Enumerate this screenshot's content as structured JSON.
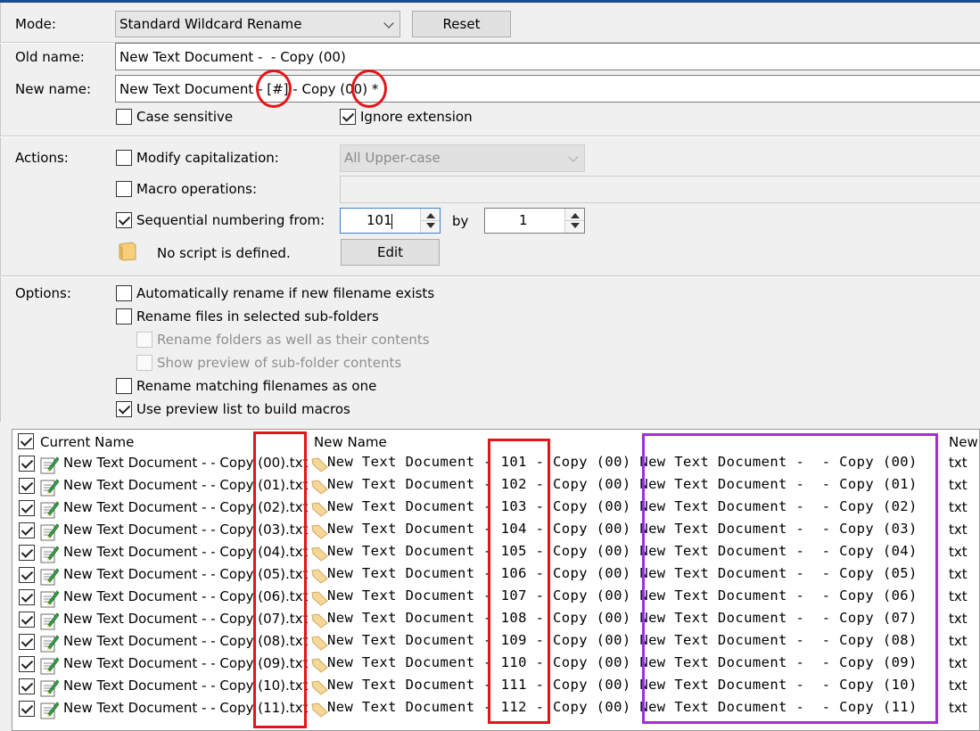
{
  "mode": {
    "label": "Mode:",
    "value": "Standard Wildcard Rename",
    "reset_label": "Reset"
  },
  "old_name": {
    "label": "Old name:",
    "value": "New Text Document -  - Copy (00)"
  },
  "new_name": {
    "label": "New name:",
    "value": "New Text Document - [#] - Copy (00) *"
  },
  "case_sensitive": {
    "label": "Case sensitive",
    "checked": false
  },
  "ignore_extension": {
    "label": "Ignore extension",
    "checked": true
  },
  "actions": {
    "label": "Actions:",
    "modify_cap": {
      "label": "Modify capitalization:",
      "checked": false,
      "value": "All Upper-case"
    },
    "macro_ops": {
      "label": "Macro operations:",
      "checked": false,
      "value": ""
    },
    "sequential": {
      "label": "Sequential numbering from:",
      "checked": true,
      "from": "101",
      "by_label": "by",
      "by": "1"
    },
    "script": {
      "text": "No script is defined.",
      "edit_label": "Edit"
    }
  },
  "options": {
    "label": "Options:",
    "items": [
      {
        "label": "Automatically rename if new filename exists",
        "checked": false,
        "enabled": true
      },
      {
        "label": "Rename files in selected sub-folders",
        "checked": false,
        "enabled": true
      },
      {
        "label": "Rename folders as well as their contents",
        "checked": false,
        "enabled": false
      },
      {
        "label": "Show preview of sub-folder contents",
        "checked": false,
        "enabled": false
      },
      {
        "label": "Rename matching filenames as one",
        "checked": false,
        "enabled": true
      },
      {
        "label": "Use preview list to build macros",
        "checked": true,
        "enabled": true
      }
    ]
  },
  "list": {
    "headers": {
      "current": "Current Name",
      "new": "New Name",
      "ext": "New"
    },
    "rows": [
      {
        "current": "New Text Document -  - Copy (00).txt",
        "new": "New Text Document - 101 - Copy (00) New Text Document -  - Copy (00)",
        "ext": "txt"
      },
      {
        "current": "New Text Document -  - Copy (01).txt",
        "new": "New Text Document - 102 - Copy (00) New Text Document -  - Copy (01)",
        "ext": "txt"
      },
      {
        "current": "New Text Document -  - Copy (02).txt",
        "new": "New Text Document - 103 - Copy (00) New Text Document -  - Copy (02)",
        "ext": "txt"
      },
      {
        "current": "New Text Document -  - Copy (03).txt",
        "new": "New Text Document - 104 - Copy (00) New Text Document -  - Copy (03)",
        "ext": "txt"
      },
      {
        "current": "New Text Document -  - Copy (04).txt",
        "new": "New Text Document - 105 - Copy (00) New Text Document -  - Copy (04)",
        "ext": "txt"
      },
      {
        "current": "New Text Document -  - Copy (05).txt",
        "new": "New Text Document - 106 - Copy (00) New Text Document -  - Copy (05)",
        "ext": "txt"
      },
      {
        "current": "New Text Document -  - Copy (06).txt",
        "new": "New Text Document - 107 - Copy (00) New Text Document -  - Copy (06)",
        "ext": "txt"
      },
      {
        "current": "New Text Document -  - Copy (07).txt",
        "new": "New Text Document - 108 - Copy (00) New Text Document -  - Copy (07)",
        "ext": "txt"
      },
      {
        "current": "New Text Document -  - Copy (08).txt",
        "new": "New Text Document - 109 - Copy (00) New Text Document -  - Copy (08)",
        "ext": "txt"
      },
      {
        "current": "New Text Document -  - Copy (09).txt",
        "new": "New Text Document - 110 - Copy (00) New Text Document -  - Copy (09)",
        "ext": "txt"
      },
      {
        "current": "New Text Document -  - Copy (10).txt",
        "new": "New Text Document - 111 - Copy (00) New Text Document -  - Copy (10)",
        "ext": "txt"
      },
      {
        "current": "New Text Document -  - Copy (11).txt",
        "new": "New Text Document - 112 - Copy (00) New Text Document -  - Copy (11)",
        "ext": "txt"
      }
    ]
  },
  "colors": {
    "highlight_red": "#e3151a",
    "highlight_purple": "#a12fd8",
    "title_bar": "#1a4d8f"
  },
  "icons": {
    "file": "text-file-icon",
    "new_file": "tag-icon",
    "script": "folder-icon"
  }
}
